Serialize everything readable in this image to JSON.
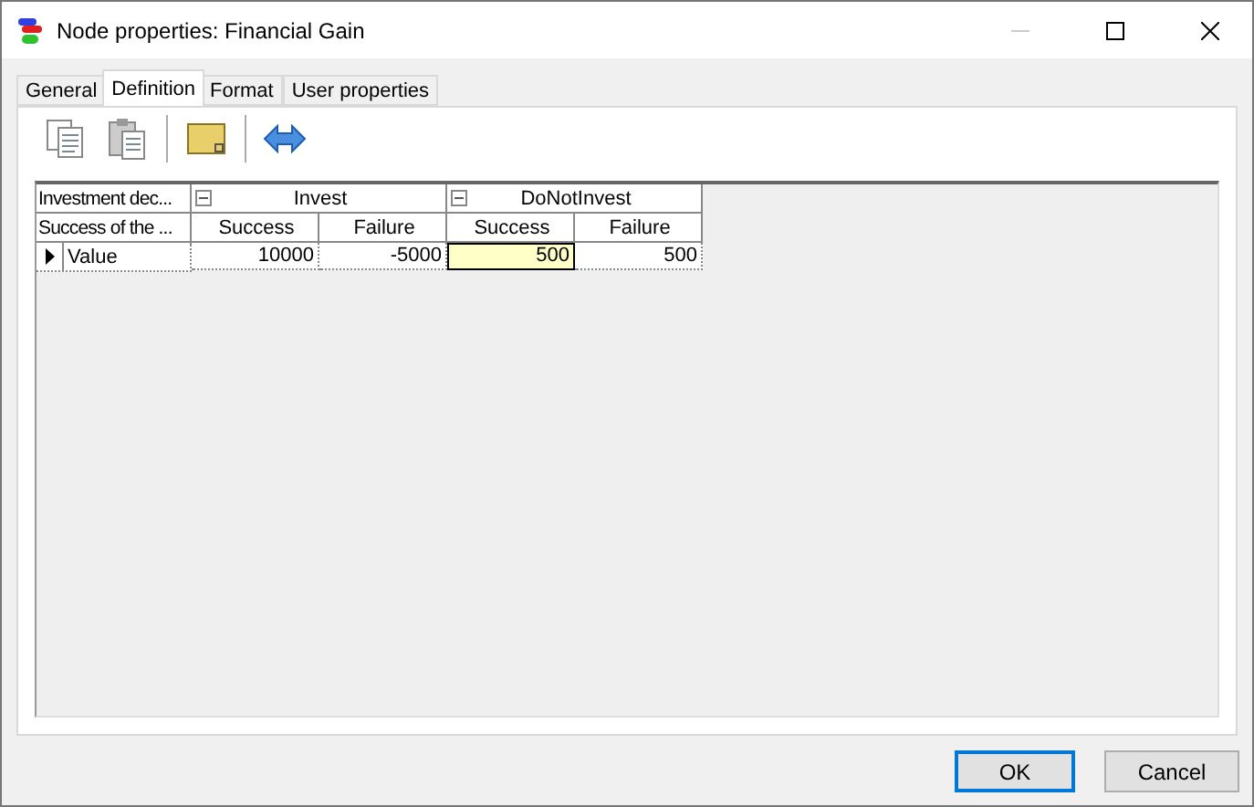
{
  "window": {
    "title": "Node properties: Financial Gain",
    "minimize_disabled": true
  },
  "tabs": [
    {
      "label": "General",
      "selected": false
    },
    {
      "label": "Definition",
      "selected": true
    },
    {
      "label": "Format",
      "selected": false
    },
    {
      "label": "User properties",
      "selected": false
    }
  ],
  "grid": {
    "corner_top": "Investment dec...",
    "corner_bottom": "Success of the ...",
    "groups": [
      {
        "label": "Invest",
        "expanded": true,
        "columns": [
          "Success",
          "Failure"
        ]
      },
      {
        "label": "DoNotInvest",
        "expanded": true,
        "columns": [
          "Success",
          "Failure"
        ]
      }
    ],
    "rows": [
      {
        "label": "Value",
        "current": true,
        "cells": [
          {
            "value": "10000",
            "selected": false
          },
          {
            "value": "-5000",
            "selected": false
          },
          {
            "value": "500",
            "selected": true
          },
          {
            "value": "500",
            "selected": false
          }
        ]
      }
    ]
  },
  "buttons": [
    {
      "label": "OK",
      "default": true
    },
    {
      "label": "Cancel",
      "default": false
    }
  ]
}
